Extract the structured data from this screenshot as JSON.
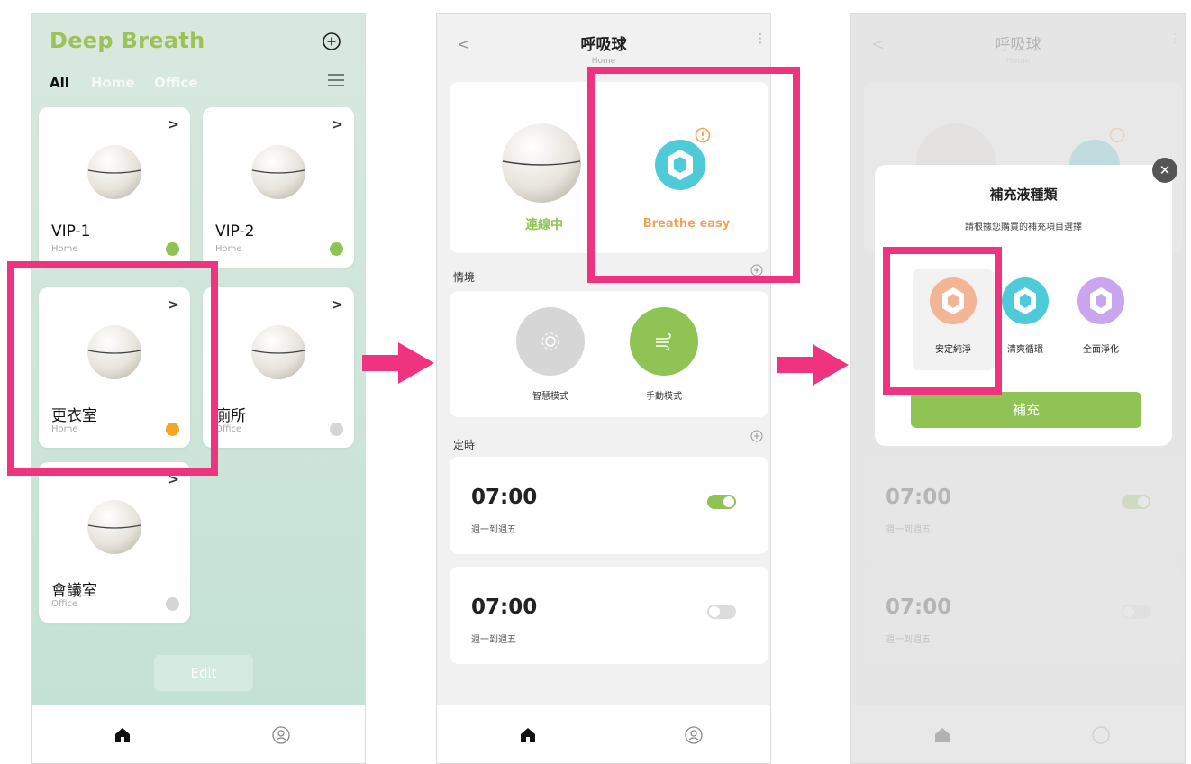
{
  "colors": {
    "accent_green": "#8fc454",
    "brand_green": "#9cc257",
    "highlight_pink": "#f0337f",
    "status_orange": "#f5a623",
    "status_gray": "#d5d5d5"
  },
  "screen1": {
    "brand": "Deep Breath",
    "tabs": [
      {
        "label": "All"
      },
      {
        "label": "Home"
      },
      {
        "label": "Office"
      }
    ],
    "devices": [
      {
        "name": "VIP-1",
        "location": "Home",
        "status": "online"
      },
      {
        "name": "VIP-2",
        "location": "Home",
        "status": "online"
      },
      {
        "name": "更衣室",
        "location": "Home",
        "status": "warning"
      },
      {
        "name": "廁所",
        "location": "Office",
        "status": "offline"
      },
      {
        "name": "會議室",
        "location": "Office",
        "status": "offline"
      }
    ],
    "chevron": ">",
    "edit_label": "Edit",
    "icons": [
      "plus-circle-icon",
      "menu-icon",
      "home-icon",
      "profile-icon"
    ]
  },
  "screen2": {
    "title": "呼吸球",
    "subtitle": "Home",
    "back": "<",
    "more": "⋮",
    "connection_status": "連線中",
    "refill_name": "Breathe easy",
    "scenes_label": "情境",
    "modes": [
      {
        "label": "智慧模式",
        "active": false
      },
      {
        "label": "手動模式",
        "active": true
      }
    ],
    "timers_label": "定時",
    "timers": [
      {
        "time": "07:00",
        "days": "週一到週五",
        "on": true
      },
      {
        "time": "07:00",
        "days": "週一到週五",
        "on": false
      }
    ]
  },
  "screen3": {
    "modal_title": "補充液種類",
    "modal_subtitle": "請根據您購買的補充項目選擇",
    "close": "✕",
    "options": [
      {
        "label": "安定純淨",
        "color": "#f3b596",
        "selected": true
      },
      {
        "label": "清爽循環",
        "color": "#4dcbd9",
        "selected": false
      },
      {
        "label": "全面淨化",
        "color": "#c9a6ee",
        "selected": false
      }
    ],
    "confirm_label": "補充"
  }
}
